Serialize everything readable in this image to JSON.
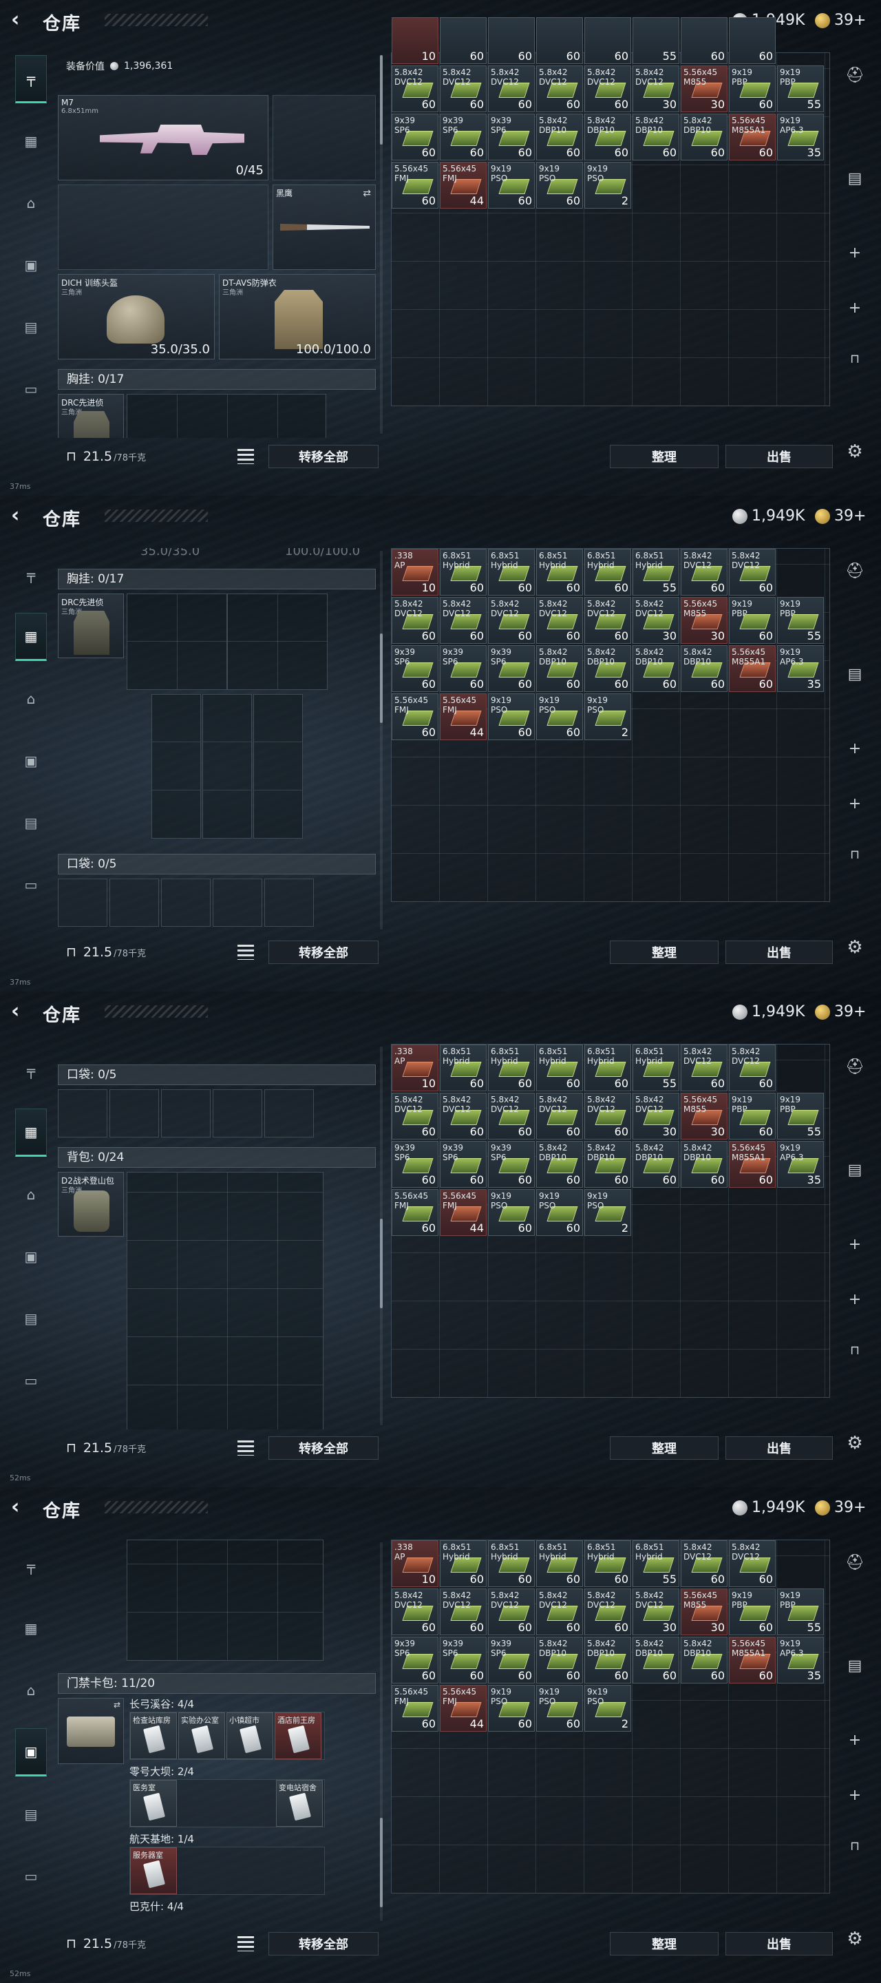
{
  "header": {
    "back_icon": "‹",
    "title": "仓库",
    "currency1": "1,949K",
    "currency2": "39+"
  },
  "sidebar_icons": [
    "pistol-icon",
    "chest-rig-icon",
    "backpack-icon",
    "keycard-bag-icon",
    "storage-box-icon",
    "toolbox-icon"
  ],
  "right_rail_icons": [
    "helmet-icon",
    "stash-icon",
    "plus-icon",
    "plus-icon",
    "lock-icon"
  ],
  "footer": {
    "weight": "21.5",
    "weight_max": "/78千克",
    "transfer_all": "转移全部",
    "sort": "整理",
    "sell": "出售",
    "status_pings": [
      "37ms",
      "37ms",
      "52ms",
      "52ms"
    ]
  },
  "loadout": {
    "value_label": "装备价值",
    "value": "1,396,361",
    "primary": {
      "name": "M7",
      "caliber": "6.8x51mm",
      "ammo": "0/45"
    },
    "melee": {
      "name": "黑鹰"
    },
    "helmet": {
      "name": "DICH 训练头盔",
      "sub": "三角洲",
      "dur": "35.0/35.0"
    },
    "armor": {
      "name": "DT-AVS防弹衣",
      "sub": "三角洲",
      "dur": "100.0/100.0"
    },
    "rig_header": "胸挂: 0/17",
    "rig_name": "DRC先进侦",
    "rig_sub": "三角洲",
    "pocket_header": "口袋: 0/5",
    "backpack_header": "背包: 0/24",
    "backpack_name": "D2战术登山包",
    "backpack_sub": "三角洲",
    "faded_dur_helmet": "35.0/35.0",
    "faded_dur_armor": "100.0/100.0",
    "keybag_header": "门禁卡包: 11/20",
    "keybag_groups": [
      {
        "title": "长弓溪谷: 4/4",
        "keys": [
          {
            "name": "检查站库房",
            "red": false
          },
          {
            "name": "实验办公室",
            "red": false
          },
          {
            "name": "小镇超市",
            "red": false
          },
          {
            "name": "酒店前王房",
            "red": true
          }
        ]
      },
      {
        "title": "零号大坝: 2/4",
        "keys": [
          {
            "name": "医务室",
            "red": false
          },
          {
            "name": "变电站宿舍",
            "red": false
          }
        ]
      },
      {
        "title": "航天基地: 1/4",
        "keys": [
          {
            "name": "服务器室",
            "red": true
          }
        ]
      },
      {
        "title": "巴克什: 4/4",
        "keys": []
      }
    ]
  },
  "stash": {
    "items": [
      {
        "name": "5.8x42\nDVC12",
        "qty": "60",
        "red": false
      },
      {
        "name": "5.8x42\nDVC12",
        "qty": "60",
        "red": false
      },
      {
        "name": "5.8x42\nDVC12",
        "qty": "60",
        "red": false
      },
      {
        "name": "5.8x42\nDVC12",
        "qty": "60",
        "red": false
      },
      {
        "name": "5.8x42\nDVC12",
        "qty": "60",
        "red": false
      },
      {
        "name": "5.8x42\nDVC12",
        "qty": "30",
        "red": false
      },
      {
        "name": "5.56x45\nM855",
        "qty": "30",
        "red": true
      },
      {
        "name": "9x19\nPBP",
        "qty": "60",
        "red": false
      },
      {
        "name": "9x19\nPBP",
        "qty": "55",
        "red": false
      },
      {
        "name": "9x39\nSP6",
        "qty": "60",
        "red": false
      },
      {
        "name": "9x39\nSP6",
        "qty": "60",
        "red": false
      },
      {
        "name": "9x39\nSP6",
        "qty": "60",
        "red": false
      },
      {
        "name": "5.8x42\nDBP10",
        "qty": "60",
        "red": false
      },
      {
        "name": "5.8x42\nDBP10",
        "qty": "60",
        "red": false
      },
      {
        "name": "5.8x42\nDBP10",
        "qty": "60",
        "red": false
      },
      {
        "name": "5.8x42\nDBP10",
        "qty": "60",
        "red": false
      },
      {
        "name": "5.56x45\nM855A1",
        "qty": "60",
        "red": true
      },
      {
        "name": "9x19\nAP6.3",
        "qty": "35",
        "red": false
      },
      {
        "name": "5.56x45\nFMJ",
        "qty": "60",
        "red": false
      },
      {
        "name": "5.56x45\nFMJ",
        "qty": "44",
        "red": true
      },
      {
        "name": "9x19\nPSO",
        "qty": "60",
        "red": false
      },
      {
        "name": "9x19\nPSO",
        "qty": "60",
        "red": false
      },
      {
        "name": "9x19\nPSO",
        "qty": "2",
        "red": false
      }
    ],
    "top_row_partial": [
      "10",
      "60",
      "60",
      "60",
      "60",
      "55",
      "60",
      "60"
    ],
    "top_row_full": [
      {
        "name": ".338\nAP",
        "qty": "10",
        "red": true
      },
      {
        "name": "6.8x51\nHybrid",
        "qty": "60",
        "red": false
      },
      {
        "name": "6.8x51\nHybrid",
        "qty": "60",
        "red": false
      },
      {
        "name": "6.8x51\nHybrid",
        "qty": "60",
        "red": false
      },
      {
        "name": "6.8x51\nHybrid",
        "qty": "60",
        "red": false
      },
      {
        "name": "6.8x51\nHybrid",
        "qty": "55",
        "red": false
      },
      {
        "name": "5.8x42\nDVC12",
        "qty": "60",
        "red": false
      },
      {
        "name": "5.8x42\nDVC12",
        "qty": "60",
        "red": false
      }
    ]
  }
}
